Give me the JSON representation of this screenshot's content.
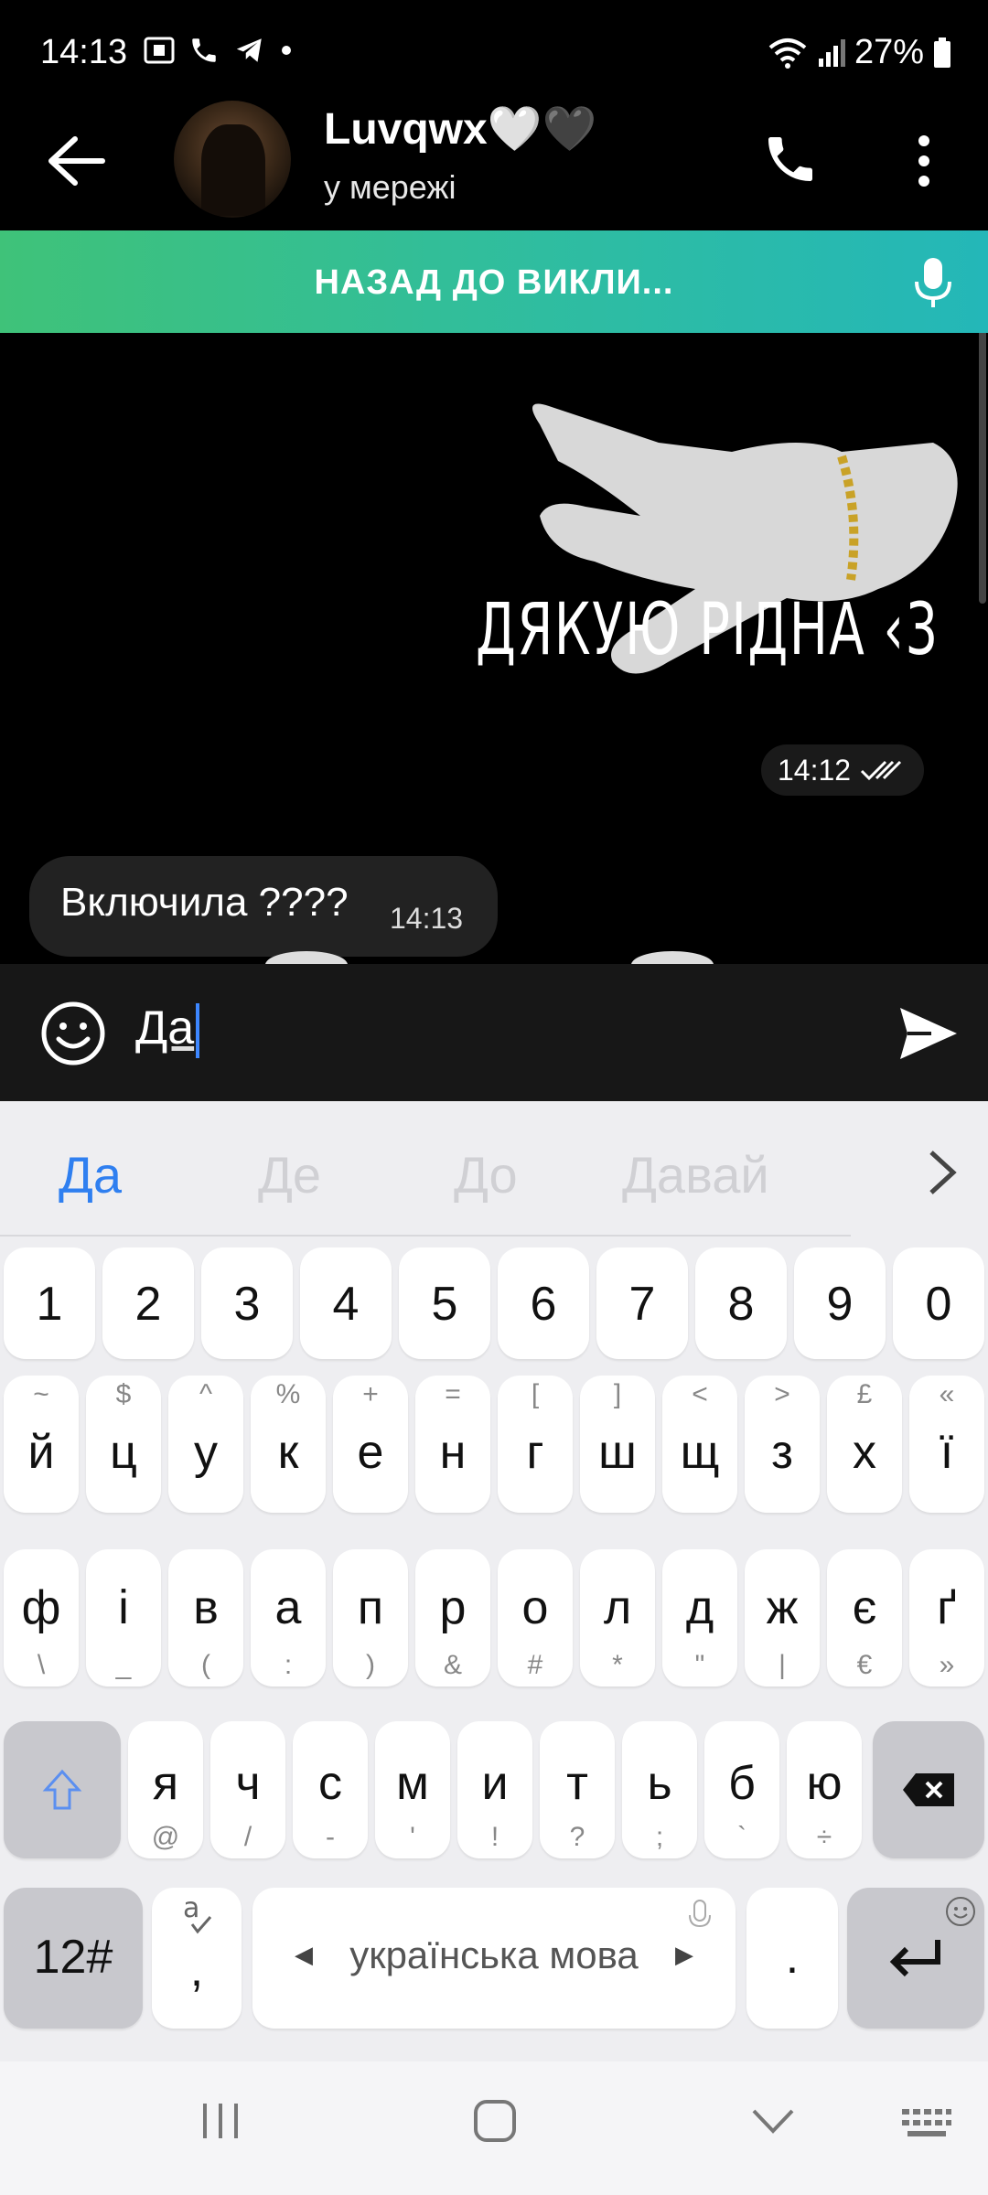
{
  "status_bar": {
    "time": "14:13",
    "battery": "27%"
  },
  "header": {
    "name": "Luvqwx🤍🖤",
    "status": "у мережі"
  },
  "call_banner": {
    "label": "НАЗАД ДО ВИКЛИ..."
  },
  "chat": {
    "sticker_text": "ДЯКУЮ РІДНА ‹3",
    "sticker_time": "14:12",
    "messages": [
      {
        "text": "Включила ????",
        "time": "14:13"
      }
    ]
  },
  "composer": {
    "value": "Да"
  },
  "keyboard": {
    "suggestions": [
      "Да",
      "Де",
      "До",
      "Давай"
    ],
    "number_row": [
      "1",
      "2",
      "3",
      "4",
      "5",
      "6",
      "7",
      "8",
      "9",
      "0"
    ],
    "row1": [
      {
        "main": "й",
        "sub": "~"
      },
      {
        "main": "ц",
        "sub": "$"
      },
      {
        "main": "у",
        "sub": "^"
      },
      {
        "main": "к",
        "sub": "%"
      },
      {
        "main": "е",
        "sub": "+"
      },
      {
        "main": "н",
        "sub": "="
      },
      {
        "main": "г",
        "sub": "["
      },
      {
        "main": "ш",
        "sub": "]"
      },
      {
        "main": "щ",
        "sub": "<"
      },
      {
        "main": "з",
        "sub": ">"
      },
      {
        "main": "х",
        "sub": "£"
      },
      {
        "main": "ї",
        "sub": "«"
      }
    ],
    "row2": [
      {
        "main": "ф",
        "sub": "\\"
      },
      {
        "main": "і",
        "sub": "_"
      },
      {
        "main": "в",
        "sub": "("
      },
      {
        "main": "а",
        "sub": ":"
      },
      {
        "main": "п",
        "sub": ")"
      },
      {
        "main": "р",
        "sub": "&"
      },
      {
        "main": "о",
        "sub": "#"
      },
      {
        "main": "л",
        "sub": "*"
      },
      {
        "main": "д",
        "sub": "\""
      },
      {
        "main": "ж",
        "sub": "|"
      },
      {
        "main": "є",
        "sub": "€"
      },
      {
        "main": "ґ",
        "sub": "»"
      }
    ],
    "row3": [
      {
        "main": "я",
        "sub": "@"
      },
      {
        "main": "ч",
        "sub": "/"
      },
      {
        "main": "с",
        "sub": "-"
      },
      {
        "main": "м",
        "sub": "'"
      },
      {
        "main": "и",
        "sub": "!"
      },
      {
        "main": "т",
        "sub": "?"
      },
      {
        "main": "ь",
        "sub": ";"
      },
      {
        "main": "б",
        "sub": "`"
      },
      {
        "main": "ю",
        "sub": "÷"
      }
    ],
    "symbols_key": "12#",
    "comma_key": ",",
    "space_label": "українська мова",
    "period_key": "."
  },
  "icons": {
    "back": "arrow-left-icon",
    "call": "phone-icon",
    "menu": "more-vert-icon",
    "mic": "microphone-icon",
    "emoji": "smile-icon",
    "send": "send-icon",
    "shift": "shift-icon",
    "backspace": "backspace-icon",
    "enter": "enter-icon"
  },
  "colors": {
    "banner_start": "#3fc279",
    "banner_end": "#24b7b8",
    "suggestion_primary": "#2f7ff0",
    "caret": "#3d87ff"
  }
}
